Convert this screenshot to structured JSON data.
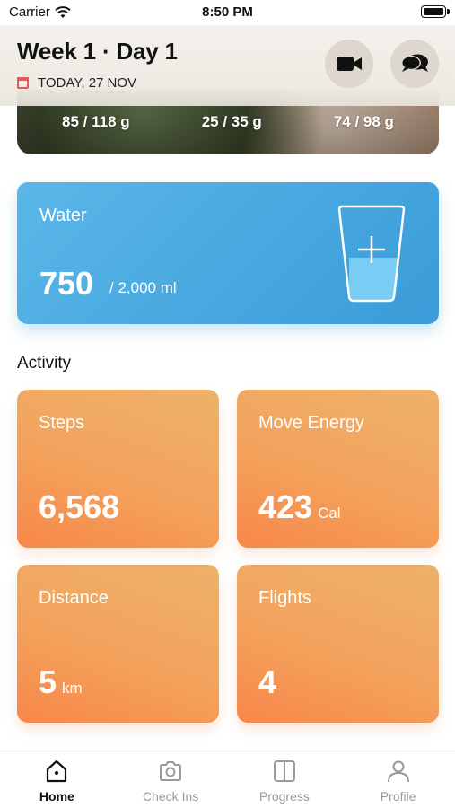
{
  "status_bar": {
    "carrier": "Carrier",
    "time": "8:50 PM"
  },
  "header": {
    "title": "Week 1 · Day 1",
    "date": "TODAY, 27 NOV"
  },
  "macros": [
    "85 / 118 g",
    "25 / 35 g",
    "74 / 98 g"
  ],
  "water": {
    "label": "Water",
    "value": "750",
    "goal": "/  2,000 ml"
  },
  "activity": {
    "title": "Activity",
    "steps": {
      "label": "Steps",
      "value": "6,568",
      "unit": ""
    },
    "move_energy": {
      "label": "Move Energy",
      "value": "423",
      "unit": "Cal"
    },
    "distance": {
      "label": "Distance",
      "value": "5",
      "unit": "km"
    },
    "flights": {
      "label": "Flights",
      "value": "4",
      "unit": ""
    }
  },
  "tabs": [
    {
      "label": "Home",
      "icon": "home-icon",
      "active": true
    },
    {
      "label": "Check Ins",
      "icon": "camera-icon",
      "active": false
    },
    {
      "label": "Progress",
      "icon": "progress-icon",
      "active": false
    },
    {
      "label": "Profile",
      "icon": "profile-icon",
      "active": false
    }
  ],
  "colors": {
    "water": "#3a9bd8",
    "activity": "#f3a25c",
    "accent_red": "#e05a5a"
  }
}
